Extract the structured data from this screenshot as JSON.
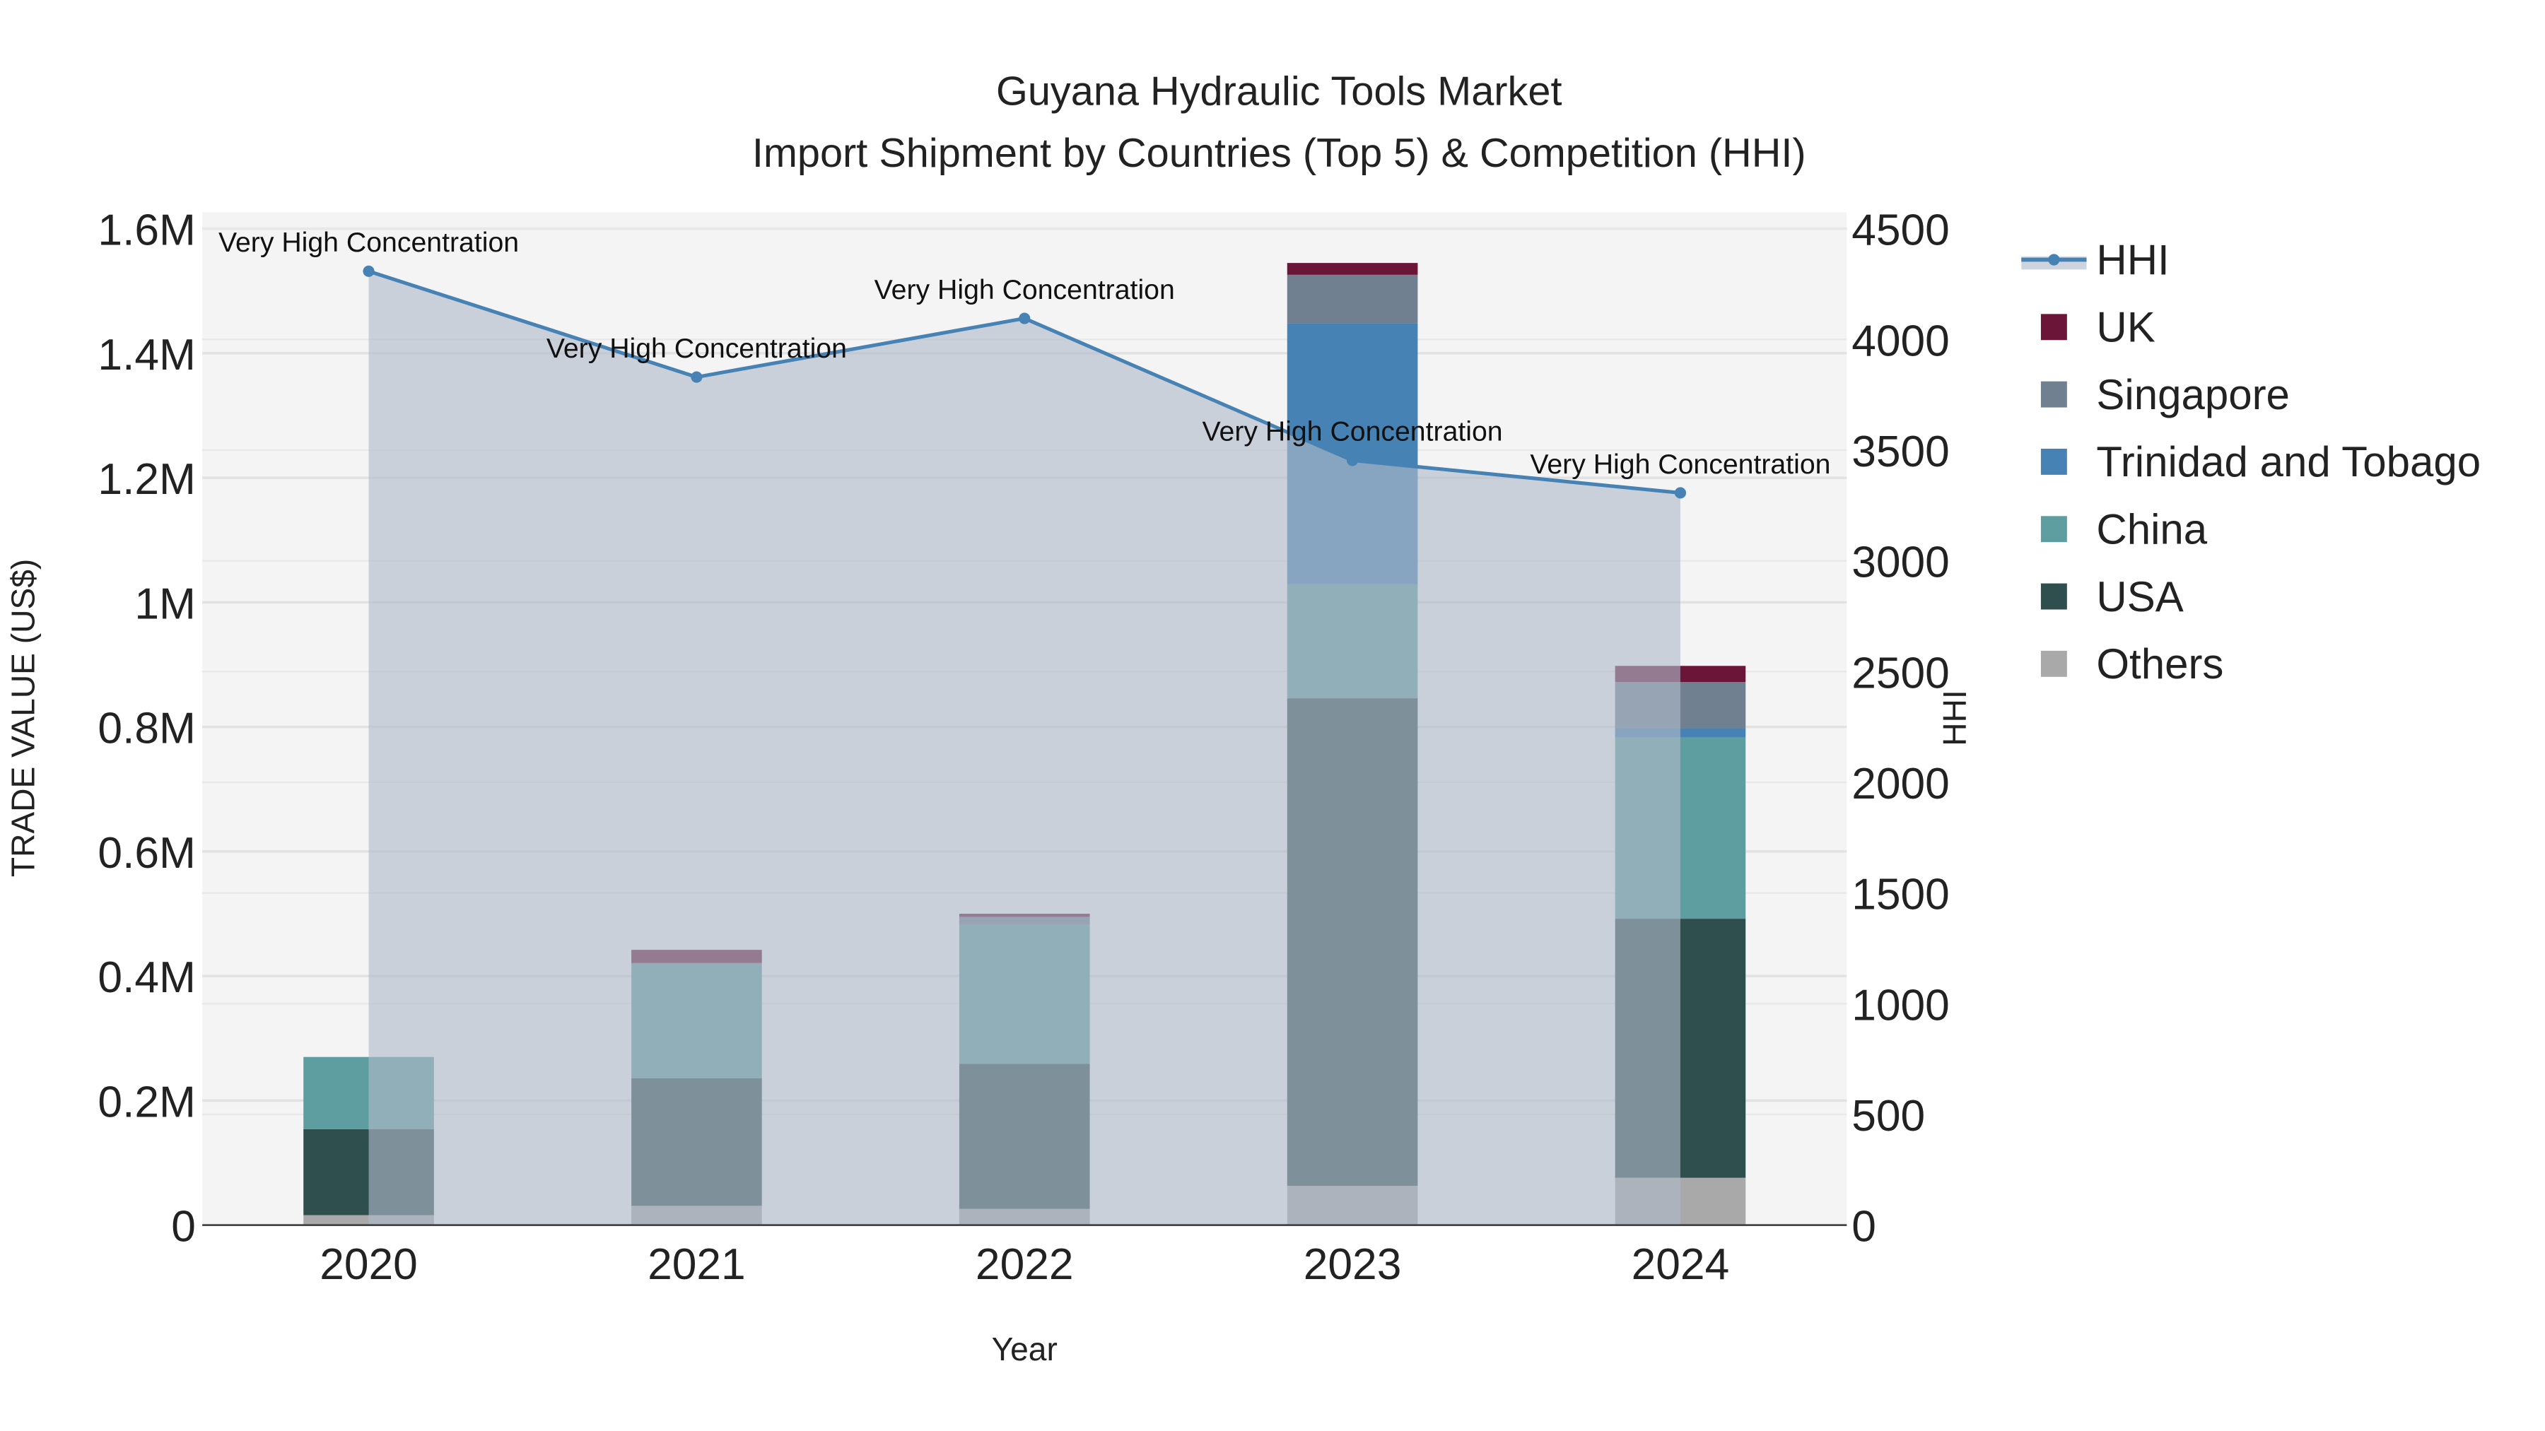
{
  "chart_data": {
    "type": "bar",
    "title": "Guyana Hydraulic Tools Market",
    "subtitle": "Import Shipment by Countries (Top 5) & Competition (HHI)",
    "xlabel": "Year",
    "ylabel": "TRADE VALUE (US$)",
    "y2label": "HHI",
    "categories": [
      "2020",
      "2021",
      "2022",
      "2023",
      "2024"
    ],
    "ylim": [
      0,
      1600000
    ],
    "y2lim": [
      0,
      4500
    ],
    "yticks": [
      0,
      200000,
      400000,
      600000,
      800000,
      1000000,
      1200000,
      1400000,
      1600000
    ],
    "ytick_labels": [
      "0",
      "0.2M",
      "0.4M",
      "0.6M",
      "0.8M",
      "1M",
      "1.2M",
      "1.4M",
      "1.6M"
    ],
    "y2ticks": [
      0,
      500,
      1000,
      1500,
      2000,
      2500,
      3000,
      3500,
      4000,
      4500
    ],
    "y2tick_labels": [
      "0",
      "500",
      "1000",
      "1500",
      "2000",
      "2500",
      "3000",
      "3500",
      "4000",
      "4500"
    ],
    "grid": true,
    "legend_placement": "right",
    "series": [
      {
        "name": "Others",
        "color": "#a9a9a9",
        "values": [
          16000,
          31000,
          26000,
          63000,
          76000
        ]
      },
      {
        "name": "USA",
        "color": "#2f4f4f",
        "values": [
          138000,
          205000,
          233000,
          783000,
          416000
        ]
      },
      {
        "name": "China",
        "color": "#5f9ea0",
        "values": [
          116000,
          183000,
          223000,
          183000,
          291000
        ]
      },
      {
        "name": "Trinidad and Tobago",
        "color": "#4682b4",
        "values": [
          0,
          0,
          0,
          419000,
          15000
        ]
      },
      {
        "name": "Singapore",
        "color": "#708090",
        "values": [
          0,
          2000,
          13000,
          78000,
          74000
        ]
      },
      {
        "name": "UK",
        "color": "#6b1538",
        "values": [
          0,
          21000,
          5000,
          19000,
          26000
        ]
      }
    ],
    "hhi": {
      "name": "HHI",
      "color": "#4682b4",
      "values": [
        4308,
        3830,
        4095,
        3454,
        3307
      ],
      "annotations": [
        "Very High Concentration",
        "Very High Concentration",
        "Very High Concentration",
        "Very High Concentration",
        "Very High Concentration"
      ]
    },
    "legend": [
      "HHI",
      "UK",
      "Singapore",
      "Trinidad and Tobago",
      "China",
      "USA",
      "Others"
    ]
  }
}
